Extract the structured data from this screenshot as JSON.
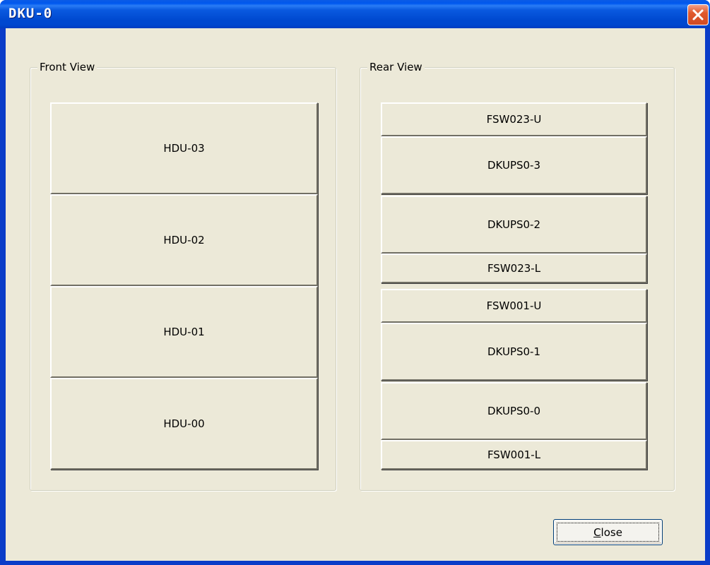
{
  "window": {
    "title": "DKU-0"
  },
  "front_view": {
    "label": "Front View",
    "units": [
      "HDU-03",
      "HDU-02",
      "HDU-01",
      "HDU-00"
    ]
  },
  "rear_view": {
    "label": "Rear View",
    "units": [
      "FSW023-U",
      "DKUPS0-3",
      "DKUPS0-2",
      "FSW023-L",
      "FSW001-U",
      "DKUPS0-1",
      "DKUPS0-0",
      "FSW001-L"
    ]
  },
  "footer": {
    "close_mnemonic": "C",
    "close_rest": "lose"
  },
  "colors": {
    "titlebar": "#0054e3",
    "client_bg": "#ece9d8",
    "close_icon_bg": "#e0592d"
  },
  "icons": {
    "title_close": "close-icon"
  }
}
